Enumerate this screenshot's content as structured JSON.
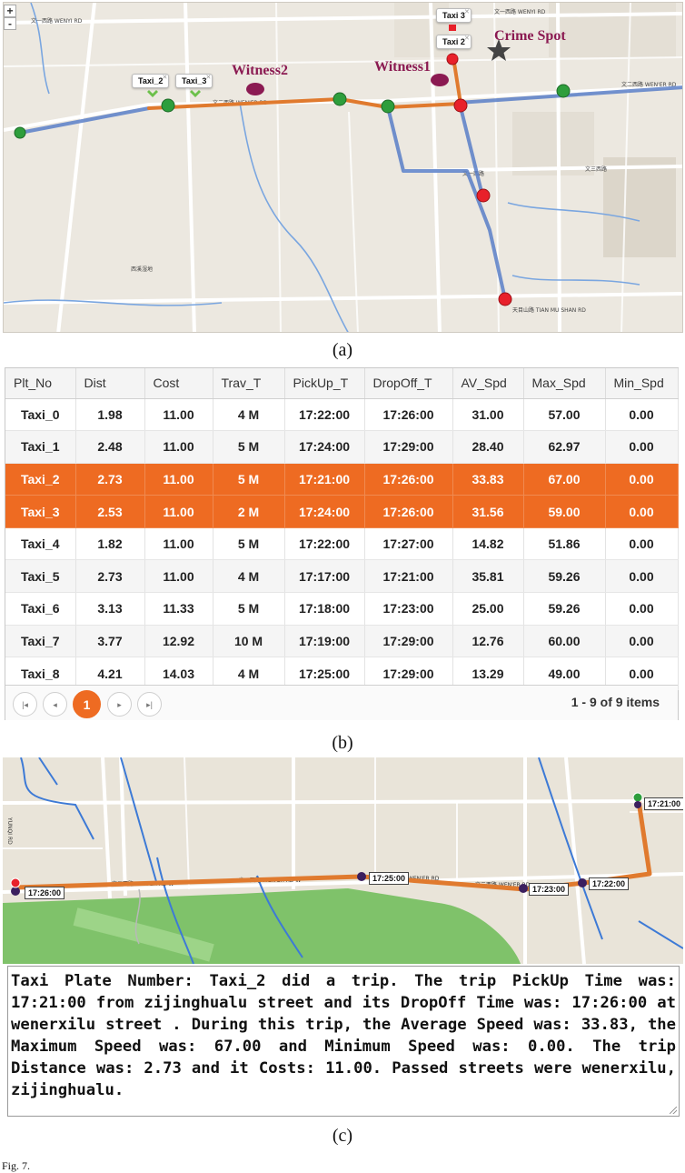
{
  "map_a": {
    "zoom_in": "+",
    "zoom_out": "-",
    "taxi_tags": [
      "Taxi_2",
      "Taxi_3",
      "Taxi 3",
      "Taxi 2"
    ],
    "labels": {
      "witness1": "Witness1",
      "witness2": "Witness2",
      "crime_spot": "Crime Spot"
    },
    "street_labels": [
      "文一西路 WENYI RD",
      "文一西路 WENYI RD",
      "文二西路 WEN'ER RD",
      "文二西路 WEN'ER RD",
      "文一西路",
      "文三西路",
      "西溪湿地",
      "天目山路 TIAN MU SHAN RD"
    ],
    "colors": {
      "route_blue": "#5a7fc8",
      "route_orange": "#e07a2e",
      "dot_green": "#2e9e3c",
      "dot_red": "#e8202a",
      "witness": "#8b1a52"
    }
  },
  "caption_a": "(a)",
  "grid": {
    "columns": [
      "Plt_No",
      "Dist",
      "Cost",
      "Trav_T",
      "PickUp_T",
      "DropOff_T",
      "AV_Spd",
      "Max_Spd",
      "Min_Spd"
    ],
    "rows": [
      [
        "Taxi_0",
        "1.98",
        "11.00",
        "4 M",
        "17:22:00",
        "17:26:00",
        "31.00",
        "57.00",
        "0.00"
      ],
      [
        "Taxi_1",
        "2.48",
        "11.00",
        "5 M",
        "17:24:00",
        "17:29:00",
        "28.40",
        "62.97",
        "0.00"
      ],
      [
        "Taxi_2",
        "2.73",
        "11.00",
        "5 M",
        "17:21:00",
        "17:26:00",
        "33.83",
        "67.00",
        "0.00"
      ],
      [
        "Taxi_3",
        "2.53",
        "11.00",
        "2 M",
        "17:24:00",
        "17:26:00",
        "31.56",
        "59.00",
        "0.00"
      ],
      [
        "Taxi_4",
        "1.82",
        "11.00",
        "5 M",
        "17:22:00",
        "17:27:00",
        "14.82",
        "51.86",
        "0.00"
      ],
      [
        "Taxi_5",
        "2.73",
        "11.00",
        "4 M",
        "17:17:00",
        "17:21:00",
        "35.81",
        "59.26",
        "0.00"
      ],
      [
        "Taxi_6",
        "3.13",
        "11.33",
        "5 M",
        "17:18:00",
        "17:23:00",
        "25.00",
        "59.26",
        "0.00"
      ],
      [
        "Taxi_7",
        "3.77",
        "12.92",
        "10 M",
        "17:19:00",
        "17:29:00",
        "12.76",
        "60.00",
        "0.00"
      ],
      [
        "Taxi_8",
        "4.21",
        "14.03",
        "4 M",
        "17:25:00",
        "17:29:00",
        "13.29",
        "49.00",
        "0.00"
      ]
    ],
    "selected_rows": [
      "Taxi_2",
      "Taxi_3"
    ],
    "pager": {
      "first": "|◂",
      "prev": "◂",
      "current_page": "1",
      "next": "▸",
      "last": "▸|",
      "info": "1 - 9 of 9 items"
    },
    "colors": {
      "selected": "#ee6b22"
    }
  },
  "caption_b": "(b)",
  "map_c": {
    "time_tags": [
      "17:21:00",
      "17:26:00",
      "17:25:00",
      "17:23:00",
      "17:22:00"
    ],
    "street_labels": [
      "文二西路 WEN'ER RD W",
      "文二西路 WEN'ER RD W",
      "文二西路 WEN'ER RD",
      "文二西路 WEN'ER RD",
      "YUNQI RD"
    ]
  },
  "description": "Taxi Plate Number: Taxi_2 did a trip. The trip PickUp Time was: 17:21:00 from zijinghualu street and its DropOff Time was: 17:26:00 at wenerxilu street . During this trip, the Average Speed was: 33.83, the Maximum Speed was: 67.00 and Minimum Speed was: 0.00. The trip Distance was: 2.73 and it Costs: 11.00. Passed streets were wenerxilu, zijinghualu.",
  "caption_c": "(c)",
  "fig_text": "Fig. 7."
}
